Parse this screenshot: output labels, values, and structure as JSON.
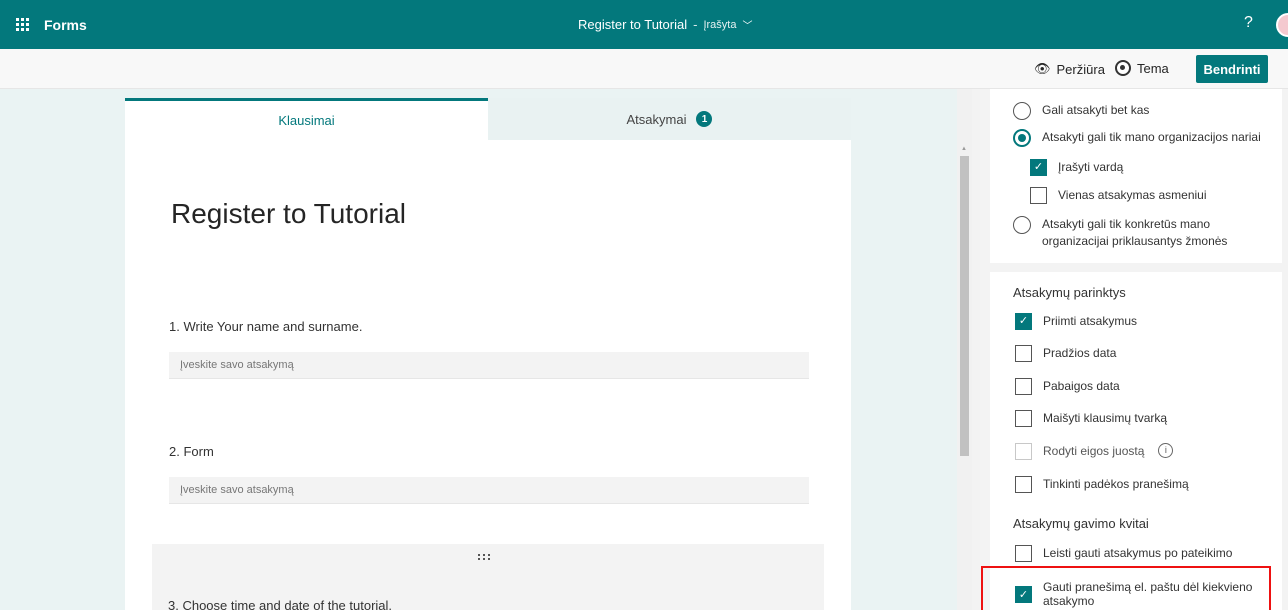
{
  "topbar": {
    "app_name": "Forms",
    "form_title": "Register to Tutorial",
    "separator": "-",
    "save_status": "Įrašyta",
    "help": "?"
  },
  "cmdbar": {
    "preview_label": "Peržiūra",
    "theme_label": "Tema",
    "share_label": "Bendrinti"
  },
  "tabs": {
    "questions": "Klausimai",
    "responses": "Atsakymai",
    "responses_count": "1"
  },
  "form": {
    "title": "Register to Tutorial",
    "questions": [
      {
        "label": "1. Write Your name and surname.",
        "placeholder": "Įveskite savo atsakymą"
      },
      {
        "label": "2. Form",
        "placeholder": "Įveskite savo atsakymą"
      },
      {
        "label": "3. Choose time and date of the tutorial."
      }
    ]
  },
  "settings": {
    "who_can_respond": [
      {
        "label": "Gali atsakyti bet kas",
        "selected": false
      },
      {
        "label": "Atsakyti gali tik mano organizacijos nariai",
        "selected": true
      },
      {
        "label": "Atsakyti gali tik konkretūs mano organizacijai priklausantys žmonės",
        "selected": false
      }
    ],
    "org_suboptions": [
      {
        "label": "Įrašyti vardą",
        "checked": true
      },
      {
        "label": "Vienas atsakymas asmeniui",
        "checked": false
      }
    ],
    "response_options_title": "Atsakymų parinktys",
    "response_options": [
      {
        "label": "Priimti atsakymus",
        "checked": true
      },
      {
        "label": "Pradžios data",
        "checked": false
      },
      {
        "label": "Pabaigos data",
        "checked": false
      },
      {
        "label": "Maišyti klausimų tvarką",
        "checked": false
      },
      {
        "label": "Rodyti eigos juostą",
        "checked": false,
        "disabled": true
      },
      {
        "label": "Tinkinti padėkos pranešimą",
        "checked": false
      }
    ],
    "receipts_title": "Atsakymų gavimo kvitai",
    "receipts": [
      {
        "label": "Leisti gauti atsakymus po pateikimo",
        "checked": false
      },
      {
        "label": "Gauti pranešimą el. paštu dėl kiekvieno atsakymo",
        "checked": true
      }
    ]
  },
  "colors": {
    "accent": "#03787c",
    "highlight": "#ee1111"
  }
}
